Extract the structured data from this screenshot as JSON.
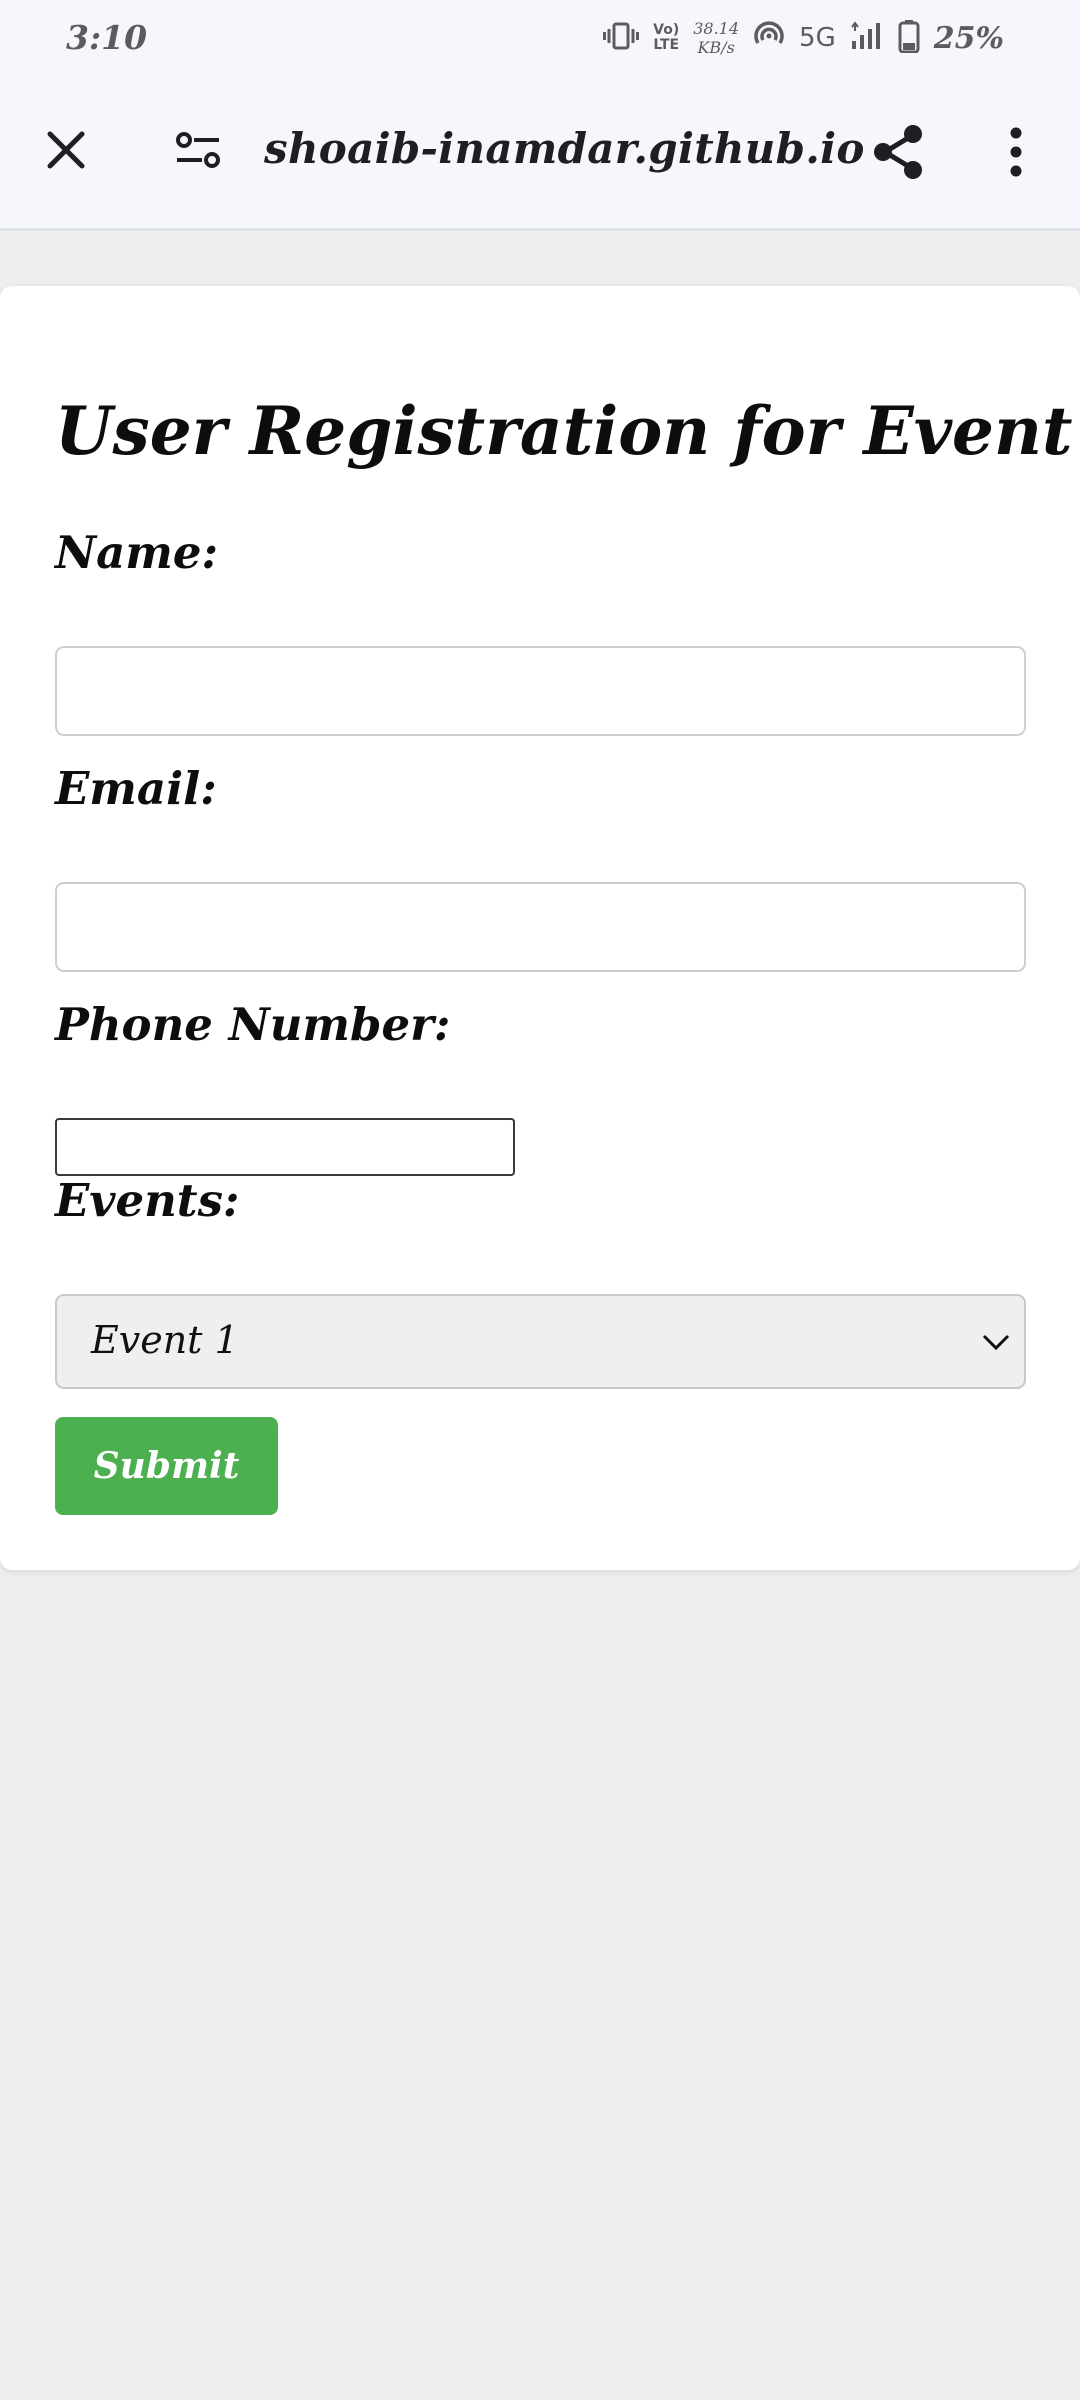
{
  "status_bar": {
    "time": "3:10",
    "volte_top": "Vo)",
    "volte_bottom": "LTE",
    "net_speed_value": "38.14",
    "net_speed_unit": "KB/s",
    "network": "5G",
    "battery": "25%"
  },
  "browser": {
    "url": "shoaib-inamdar.github.io"
  },
  "form": {
    "title": "User Registration for Event",
    "name_label": "Name:",
    "name_value": "",
    "email_label": "Email:",
    "email_value": "",
    "phone_label": "Phone Number:",
    "phone_value": "",
    "events_label": "Events:",
    "events_selected": "Event 1",
    "submit_label": "Submit"
  },
  "colors": {
    "submit_bg": "#4caf50",
    "page_bg": "#efefef",
    "toolbar_bg": "#f6f7fc"
  }
}
